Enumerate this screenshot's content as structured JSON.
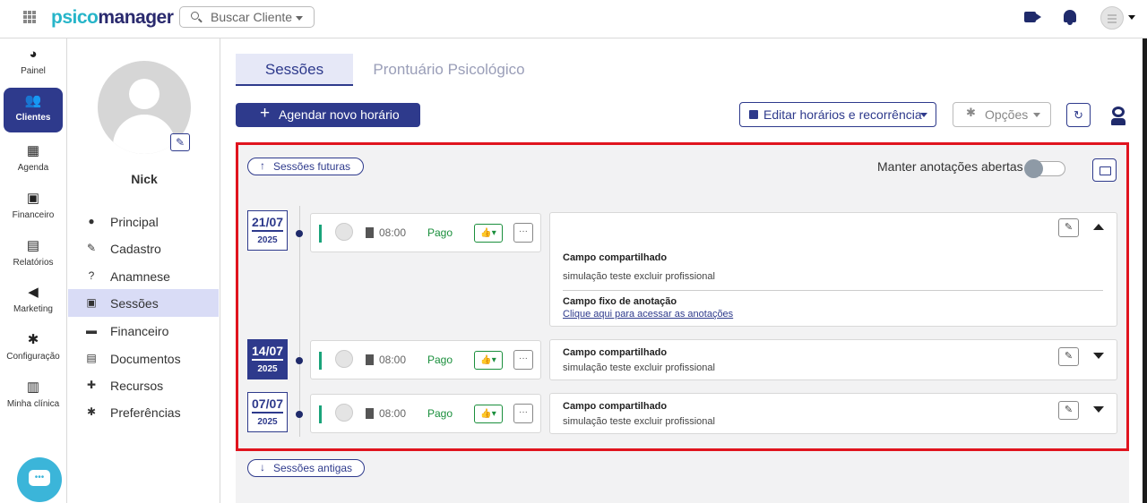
{
  "topbar": {
    "logo_part1": "psico",
    "logo_part2": "manager",
    "search_placeholder": "Buscar Cliente"
  },
  "rail": {
    "items": [
      {
        "label": "Painel",
        "icon": "dashboard-icon"
      },
      {
        "label": "Clientes",
        "icon": "users-icon",
        "active": true
      },
      {
        "label": "Agenda",
        "icon": "calendar-icon"
      },
      {
        "label": "Financeiro",
        "icon": "money-icon"
      },
      {
        "label": "Relatórios",
        "icon": "report-icon"
      },
      {
        "label": "Marketing",
        "icon": "megaphone-icon"
      },
      {
        "label": "Configuração",
        "icon": "gear-icon"
      },
      {
        "label": "Minha clínica",
        "icon": "building-icon"
      }
    ]
  },
  "client": {
    "name": "Nick",
    "menu": [
      {
        "label": "Principal",
        "icon": "person-icon"
      },
      {
        "label": "Cadastro",
        "icon": "edit-icon"
      },
      {
        "label": "Anamnese",
        "icon": "question-icon"
      },
      {
        "label": "Sessões",
        "icon": "medkit-icon",
        "active": true
      },
      {
        "label": "Financeiro",
        "icon": "money-icon"
      },
      {
        "label": "Documentos",
        "icon": "document-icon"
      },
      {
        "label": "Recursos",
        "icon": "puzzle-icon"
      },
      {
        "label": "Preferências",
        "icon": "gear-icon"
      }
    ]
  },
  "tabs": {
    "sessions": "Sessões",
    "record": "Prontuário Psicológico"
  },
  "toolbar": {
    "schedule": "Agendar novo horário",
    "edit_schedule": "Editar horários e recorrência",
    "options": "Opções"
  },
  "panel": {
    "future": "Sessões futuras",
    "keep_notes": "Manter anotações abertas",
    "past": "Sessões antigas",
    "sessions": [
      {
        "day": "21/07",
        "year": "2025",
        "time": "08:00",
        "status": "Pago",
        "note_title": "Campo compartilhado",
        "note_text": "simulação teste excluir profissional",
        "fixed_title": "Campo fixo de anotação",
        "fixed_link": "Clique aqui para acessar as anotações"
      },
      {
        "day": "14/07",
        "year": "2025",
        "time": "08:00",
        "status": "Pago",
        "note_title": "Campo compartilhado",
        "note_text": "simulação teste excluir profissional"
      },
      {
        "day": "07/07",
        "year": "2025",
        "time": "08:00",
        "status": "Pago",
        "note_title": "Campo compartilhado",
        "note_text": "simulação teste excluir profissional"
      }
    ]
  },
  "colors": {
    "primary": "#2e3a8c",
    "accent": "#27b5c9",
    "paid": "#1a8f3c",
    "highlight": "#e0141e"
  }
}
